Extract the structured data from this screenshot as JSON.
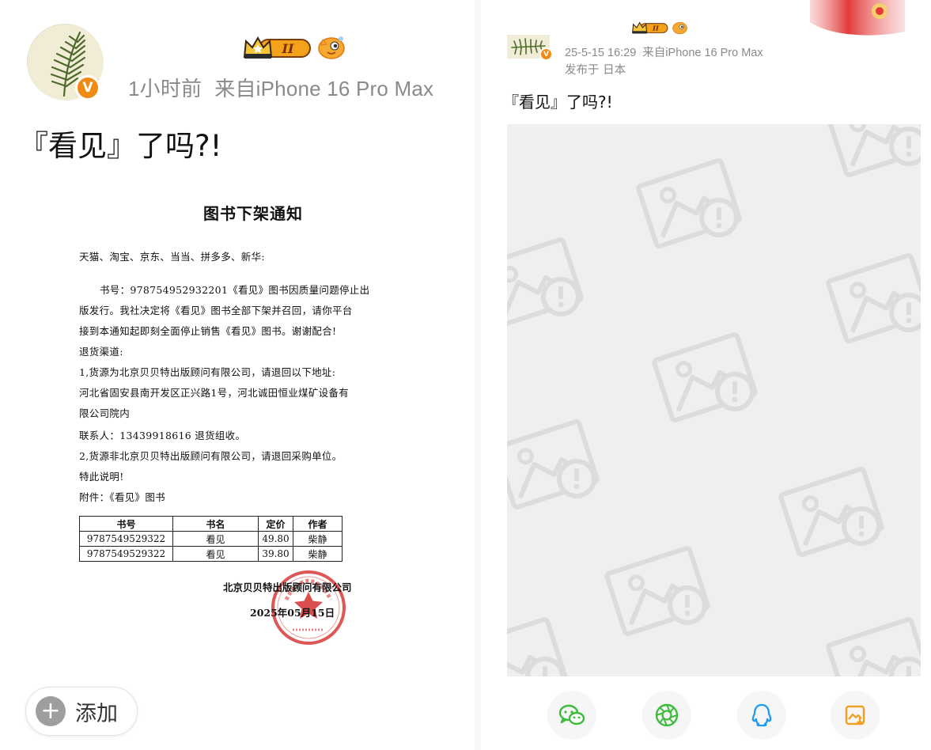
{
  "left": {
    "meta": {
      "time": "1小时前",
      "source": "来自iPhone 16 Pro Max"
    },
    "post_text": "『看见』了吗?!",
    "notice": {
      "title": "图书下架通知",
      "lines": [
        "天猫、淘宝、京东、当当、拼多多、新华:",
        "书号：978754952932201《看见》图书因质量问题停止出",
        "版发行。我社决定将《看见》图书全部下架并召回，请你平台",
        "接到本通知起即刻全面停止销售《看见》图书。谢谢配合!",
        "退货渠道:",
        "1,货源为北京贝贝特出版顾问有限公司，请退回以下地址:",
        "河北省固安县南开发区正兴路1号，河北诚田恒业煤矿设备有",
        "限公司院内",
        "联系人：13439918616   退货组收。",
        "2,货源非北京贝贝特出版顾问有限公司，请退回采购单位。",
        "特此说明!",
        "附件：《看见》图书"
      ],
      "table": {
        "headers": [
          "书号",
          "书名",
          "定价",
          "作者"
        ],
        "rows": [
          [
            "9787549529322",
            "看见",
            "49.80",
            "柴静"
          ],
          [
            "9787549529322",
            "看见",
            "39.80",
            "柴静"
          ]
        ]
      },
      "company": "北京贝贝特出版顾问有限公司",
      "date": "2025年05月15日"
    },
    "add_button": {
      "label": "添加",
      "icon": "plus-icon"
    }
  },
  "right": {
    "meta": {
      "datetime": "25-5-15 16:29",
      "source": "来自iPhone 16 Pro Max"
    },
    "location": "发布于 日本",
    "post_text": "『看见』了吗?!"
  },
  "badges": {
    "level_text": "II",
    "verified_mark": "V"
  },
  "share_buttons": [
    {
      "name": "wechat-share-button",
      "icon": "wechat-icon",
      "color": "#3dbb3d"
    },
    {
      "name": "moments-share-button",
      "icon": "moments-icon",
      "color": "#3dbb3d"
    },
    {
      "name": "qq-share-button",
      "icon": "qq-icon",
      "color": "#1e9bf0"
    },
    {
      "name": "save-image-button",
      "icon": "save-image-icon",
      "color": "#f0a020"
    }
  ],
  "colors": {
    "vip_orange": "#f08a12",
    "meta_gray": "#8a8a8a",
    "placeholder_bg": "#efefef"
  }
}
